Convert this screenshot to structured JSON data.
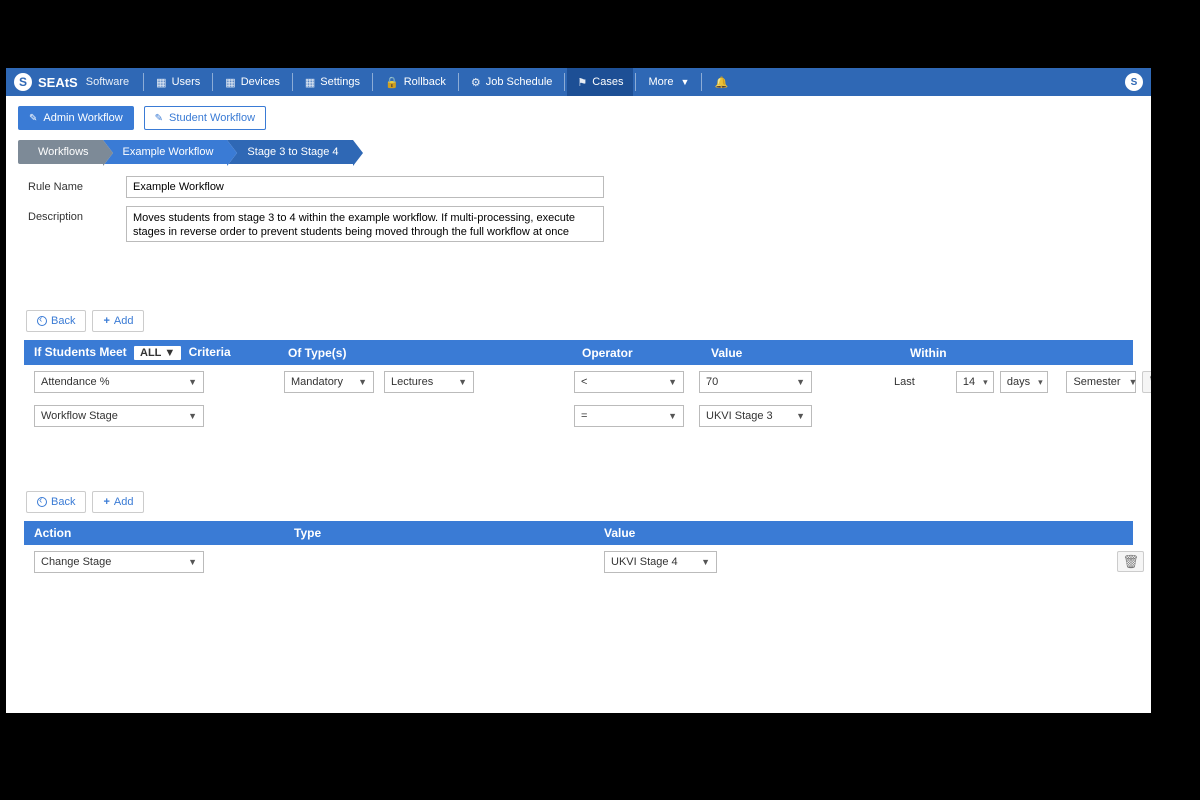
{
  "brand": {
    "name": "SEAtS",
    "sub": "Software",
    "logoLetter": "S"
  },
  "nav": {
    "items": [
      {
        "label": "Users"
      },
      {
        "label": "Devices"
      },
      {
        "label": "Settings"
      },
      {
        "label": "Rollback"
      },
      {
        "label": "Job Schedule"
      },
      {
        "label": "Cases"
      },
      {
        "label": "More"
      }
    ],
    "userBadge": "S"
  },
  "tabs": {
    "admin": "Admin Workflow",
    "student": "Student Workflow"
  },
  "breadcrumbs": {
    "root": "Workflows",
    "mid": "Example Workflow",
    "leaf": "Stage 3 to Stage 4"
  },
  "form": {
    "ruleNameLabel": "Rule Name",
    "ruleName": "Example Workflow",
    "descriptionLabel": "Description",
    "description": "Moves students from stage 3 to 4 within the example workflow. If multi-processing, execute stages in reverse order to prevent students being moved through the full workflow at once"
  },
  "buttons": {
    "back": "Back",
    "add": "Add"
  },
  "criteria": {
    "header": {
      "prefix": "If Students Meet",
      "allLabel": "ALL",
      "suffix": "Criteria",
      "ofTypes": "Of Type(s)",
      "operator": "Operator",
      "value": "Value",
      "within": "Within"
    },
    "rows": [
      {
        "field": "Attendance %",
        "type1": "Mandatory",
        "type2": "Lectures",
        "operator": "<",
        "value": "70",
        "withinLast": "Last",
        "withinNum": "14",
        "withinUnit": "days",
        "withinScope": "Semester"
      },
      {
        "field": "Workflow Stage",
        "operator": "=",
        "value": "UKVI Stage 3"
      }
    ]
  },
  "actions": {
    "header": {
      "action": "Action",
      "type": "Type",
      "value": "Value"
    },
    "rows": [
      {
        "action": "Change Stage",
        "value": "UKVI Stage 4"
      }
    ]
  }
}
